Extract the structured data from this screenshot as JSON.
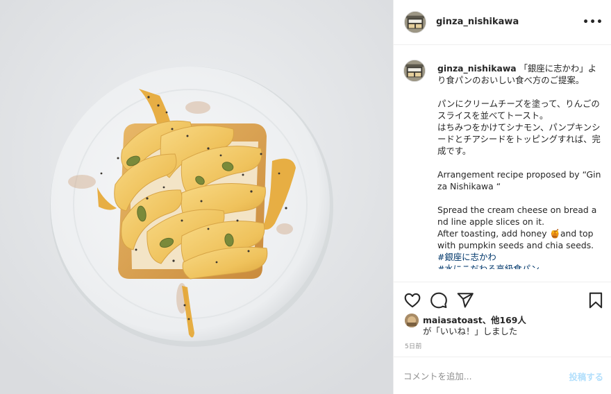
{
  "post": {
    "username": "ginza_nishikawa",
    "more_glyph": "•••",
    "photo_subject": ""
  },
  "caption": {
    "username": "ginza_nishikawa",
    "lines": [
      "「銀座に志かわ」より食パンのおいしい食べ方のご提案。",
      "",
      "パンにクリームチーズを塗って、りんごのスライスを並べてトースト。",
      "はちみつをかけてシナモン、パンプキンシードとチアシードをトッピングすれば、完成です。",
      "",
      "Arrangement recipe proposed by “Ginza Nishikawa “",
      "",
      "Spread the cream cheese on bread and line apple slices on it.",
      "After toasting, add honey 🍯and top with pumpkin seeds and chia seeds.",
      ""
    ],
    "hashtags": [
      "#銀座に志かわ",
      "#水にこだわる高級食パン"
    ]
  },
  "actions": {
    "like_icon": "heart-icon",
    "comment_icon": "comment-icon",
    "share_icon": "paper-plane-icon",
    "save_icon": "bookmark-icon"
  },
  "likes": {
    "first_liker": "maiasatoast",
    "others": "、他169人",
    "suffix": "が「いいね！」しました"
  },
  "date": "5日前",
  "comment_box": {
    "placeholder": "コメントを追加...",
    "post_label": "投稿する"
  },
  "colors": {
    "text": "#262626",
    "secondary": "#8e8e8e",
    "link": "#00376b",
    "post_button_disabled": "#b2dffc",
    "border": "#efefef"
  }
}
